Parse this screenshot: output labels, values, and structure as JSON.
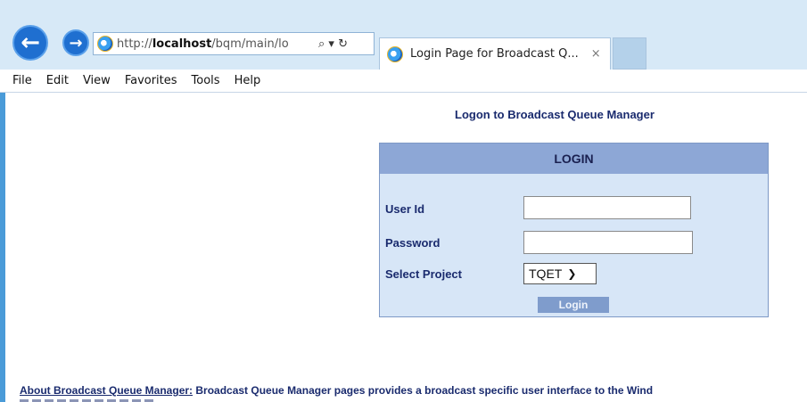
{
  "browser": {
    "url_prefix": "http://",
    "url_host": "localhost",
    "url_path": "/bqm/main/lo",
    "address_controls": "⌕ ▾ ↻",
    "tab_title": "Login Page for Broadcast Q...",
    "tab_close": "×"
  },
  "menu": [
    "File",
    "Edit",
    "View",
    "Favorites",
    "Tools",
    "Help"
  ],
  "page": {
    "heading": "Logon to Broadcast Queue Manager",
    "login_header": "LOGIN",
    "user_id_label": "User Id",
    "user_id_value": "",
    "password_label": "Password",
    "password_value": "",
    "project_label": "Select Project",
    "project_selected": "TQET",
    "login_button": "Login",
    "about_link": "About Broadcast Queue Manager:",
    "about_text": " Broadcast Queue Manager pages provides a broadcast specific user interface to the Wind"
  }
}
